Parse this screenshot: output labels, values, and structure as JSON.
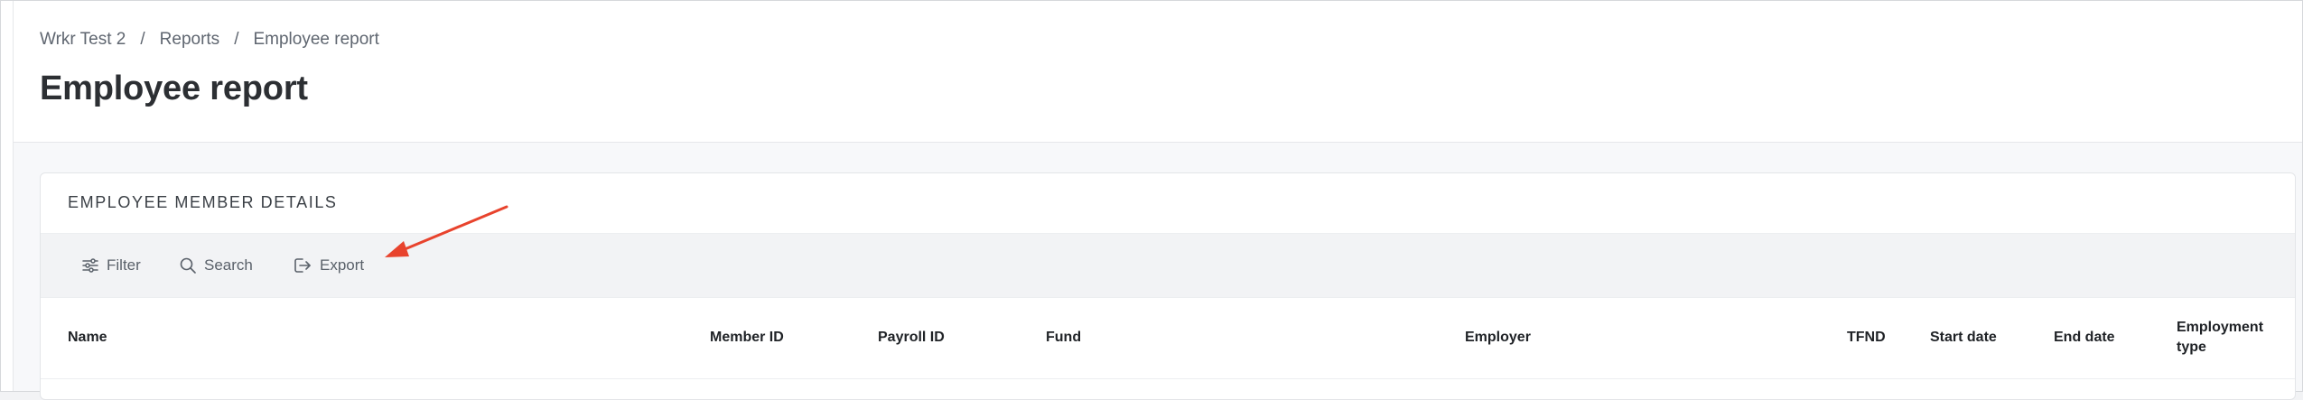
{
  "breadcrumb": {
    "items": [
      "Wrkr Test 2",
      "Reports",
      "Employee report"
    ],
    "separator": "/"
  },
  "page": {
    "title": "Employee report"
  },
  "card": {
    "title": "EMPLOYEE MEMBER DETAILS"
  },
  "toolbar": {
    "filter_label": "Filter",
    "search_label": "Search",
    "export_label": "Export",
    "filter_icon": "sliders-icon",
    "search_icon": "search-icon",
    "export_icon": "export-icon"
  },
  "table": {
    "columns": [
      "Name",
      "Member ID",
      "Payroll ID",
      "Fund",
      "Employer",
      "TFND",
      "Start date",
      "End date",
      "Employment type"
    ]
  },
  "annotation": {
    "color": "#e8432d",
    "icon": "red-arrow"
  }
}
